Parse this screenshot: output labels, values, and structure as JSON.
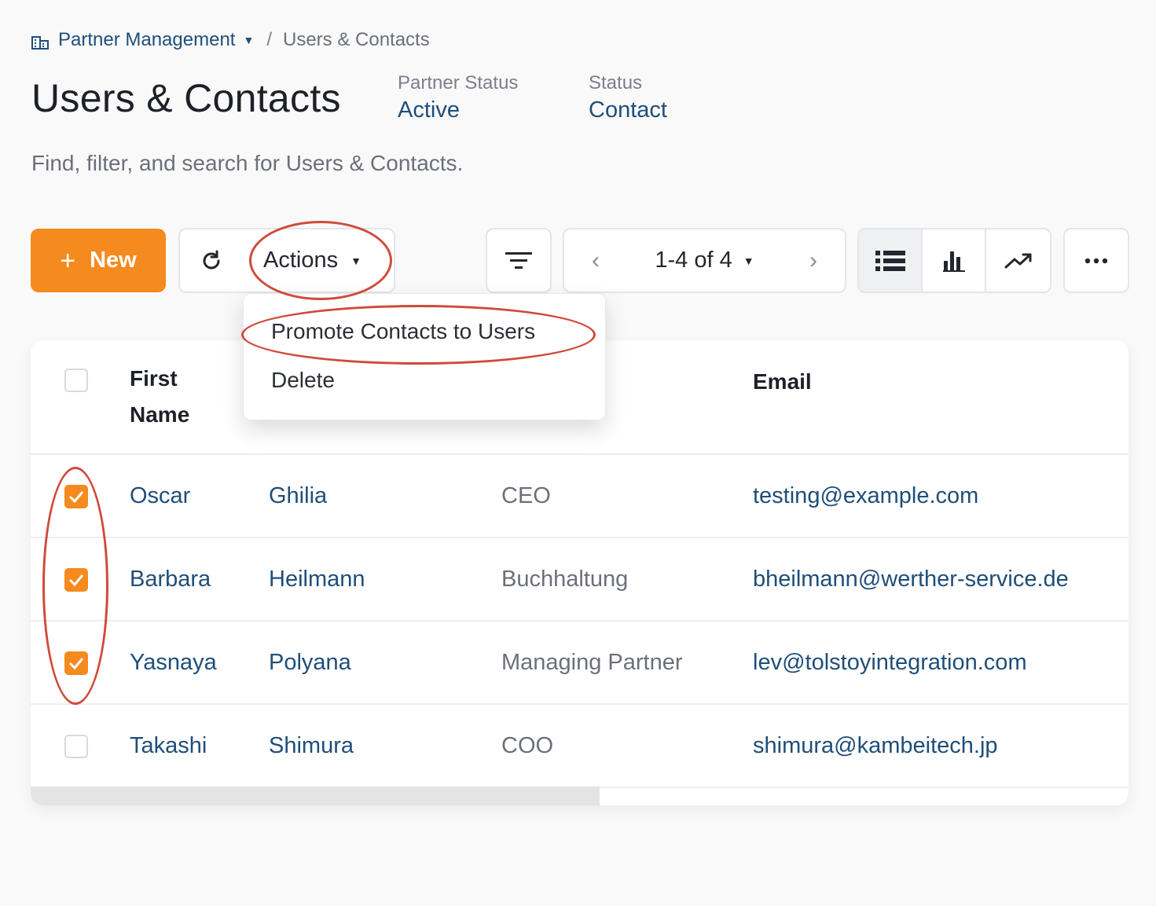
{
  "breadcrumb": {
    "root": "Partner Management",
    "separator": "/",
    "current": "Users & Contacts"
  },
  "header": {
    "title": "Users & Contacts",
    "meta": [
      {
        "label": "Partner Status",
        "value": "Active"
      },
      {
        "label": "Status",
        "value": "Contact"
      }
    ],
    "subtitle": "Find, filter, and search for Users & Contacts."
  },
  "toolbar": {
    "new_label": "New",
    "actions_label": "Actions",
    "pager_label": "1-4 of 4"
  },
  "actions_menu": {
    "items": [
      "Promote Contacts to Users",
      "Delete"
    ]
  },
  "table": {
    "columns": {
      "first_name": "First Name",
      "email": "Email"
    },
    "rows": [
      {
        "checked": true,
        "first": "Oscar",
        "last": "Ghilia",
        "title": "CEO",
        "email": "testing@example.com"
      },
      {
        "checked": true,
        "first": "Barbara",
        "last": "Heilmann",
        "title": "Buchhaltung",
        "email": "bheilmann@werther-service.de"
      },
      {
        "checked": true,
        "first": "Yasnaya",
        "last": "Polyana",
        "title": "Managing Partner",
        "email": "lev@tolstoyintegration.com"
      },
      {
        "checked": false,
        "first": "Takashi",
        "last": "Shimura",
        "title": "COO",
        "email": "shimura@kambeitech.jp"
      }
    ]
  },
  "colors": {
    "accent": "#f58a1f",
    "link": "#1f4e79",
    "annotation": "#d04a3b"
  }
}
